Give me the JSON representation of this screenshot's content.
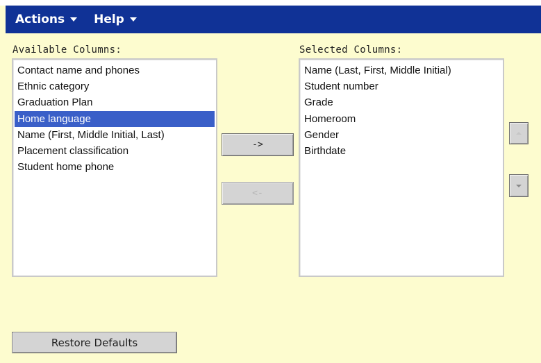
{
  "menubar": {
    "items": [
      {
        "label": "Actions"
      },
      {
        "label": "Help"
      }
    ]
  },
  "available": {
    "label": "Available Columns:",
    "items": [
      {
        "label": "Contact name and phones",
        "selected": false
      },
      {
        "label": "Ethnic category",
        "selected": false
      },
      {
        "label": "Graduation Plan",
        "selected": false
      },
      {
        "label": "Home language",
        "selected": true
      },
      {
        "label": "Name (First, Middle Initial, Last)",
        "selected": false
      },
      {
        "label": "Placement classification",
        "selected": false
      },
      {
        "label": "Student home phone",
        "selected": false
      }
    ]
  },
  "selected": {
    "label": "Selected Columns:",
    "items": [
      {
        "label": "Name (Last, First, Middle Initial)"
      },
      {
        "label": "Student number"
      },
      {
        "label": "Grade"
      },
      {
        "label": "Homeroom"
      },
      {
        "label": "Gender"
      },
      {
        "label": "Birthdate"
      }
    ]
  },
  "buttons": {
    "add": "->",
    "remove": "<-",
    "restore": "Restore Defaults"
  },
  "colors": {
    "menubar": "#103296",
    "background": "#fdfccf",
    "selection": "#3a5fc8"
  }
}
